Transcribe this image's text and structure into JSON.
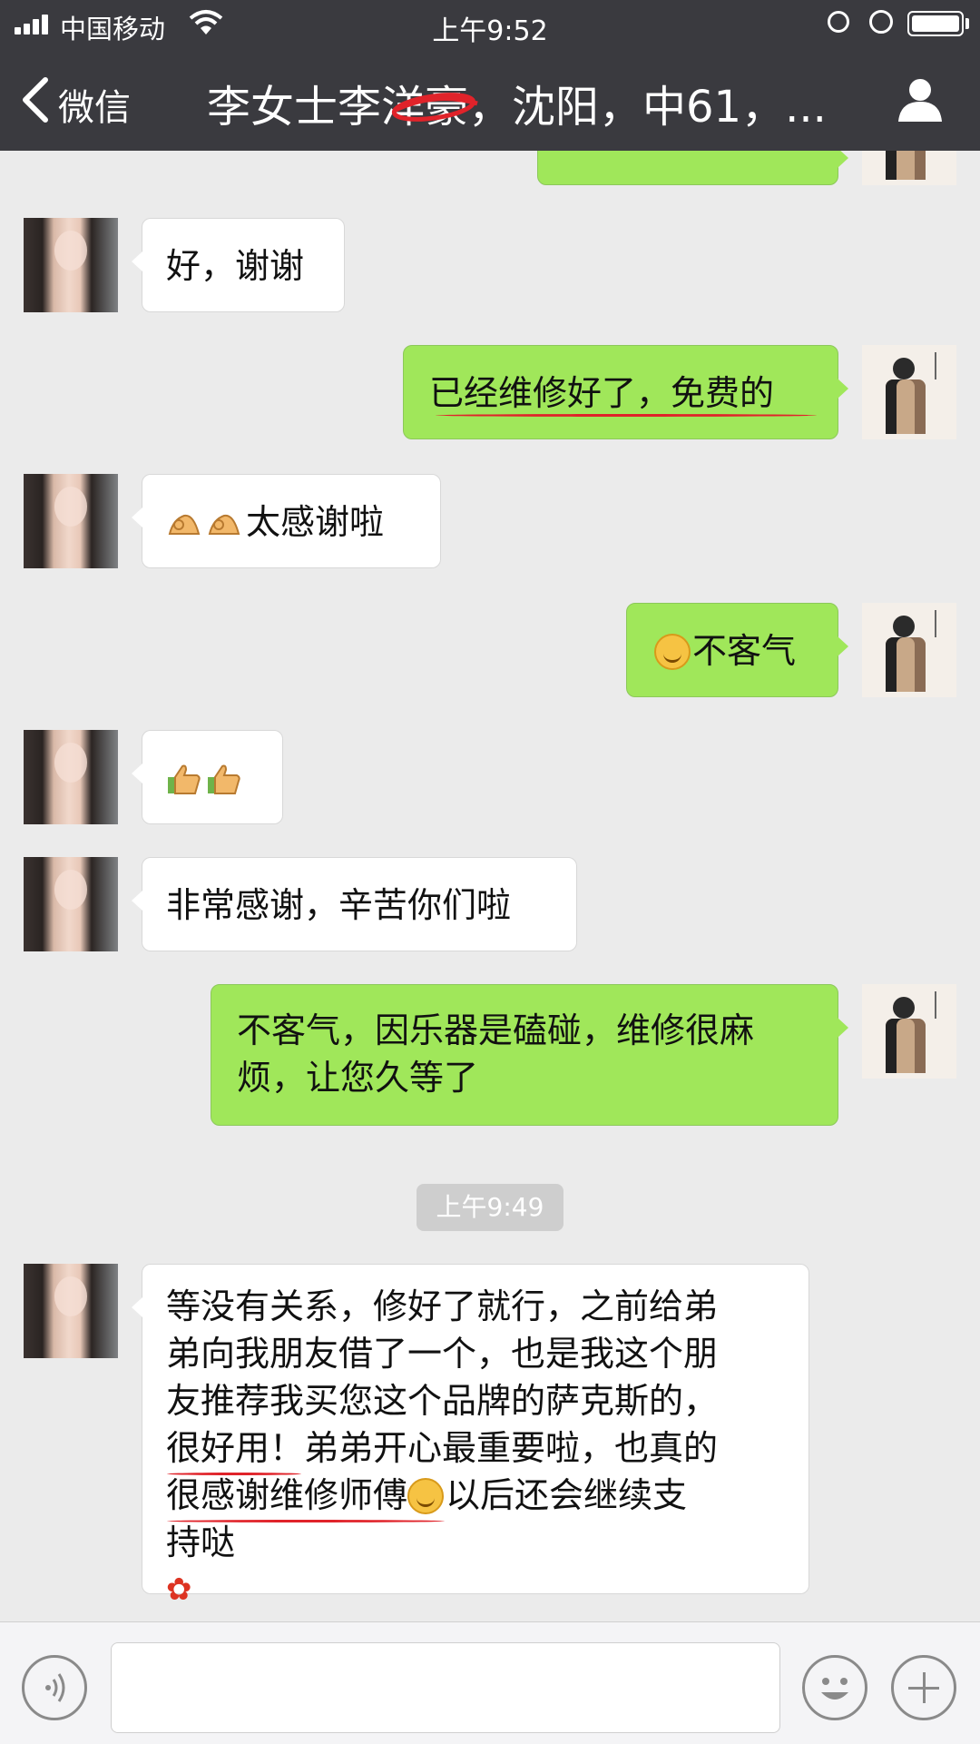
{
  "status_bar": {
    "carrier": "中国移动",
    "time": "上午9:52"
  },
  "nav": {
    "back_label": "微信",
    "title": "李女士李洋豪，沈阳，中61，..."
  },
  "messages": [
    {
      "side": "out",
      "text": "",
      "note": "partially hidden bubble"
    },
    {
      "side": "in",
      "text": "好，谢谢"
    },
    {
      "side": "out",
      "text": "已经维修好了，免费的"
    },
    {
      "side": "in",
      "text": "太感谢啦",
      "emoji": "ok-hand x2"
    },
    {
      "side": "out",
      "text": "不客气",
      "emoji": "smile"
    },
    {
      "side": "in",
      "text": "",
      "emoji": "thumbs-up x2"
    },
    {
      "side": "in",
      "text": "非常感谢，辛苦你们啦"
    },
    {
      "side": "out",
      "lines": [
        "不客气，因乐器是磕碰，维修很麻",
        "烦，让您久等了"
      ]
    },
    {
      "side": "in",
      "lines": [
        "等没有关系，修好了就行，之前给弟",
        "弟向我朋友借了一个，也是我这个朋",
        "友推荐我买您这个品牌的萨克斯的，",
        "很好用！弟弟开心最重要啦，也真的",
        "很感谢维修师傅",
        "以后还会继续支",
        "持哒"
      ]
    }
  ],
  "timestamp": "上午9:49",
  "icons": {
    "back": "chevron-left-icon",
    "profile": "person-icon",
    "voice": "voice-icon",
    "emoji": "smiley-icon",
    "plus": "plus-icon"
  },
  "colors": {
    "nav_bg": "#3a3a3f",
    "chat_bg": "#ebebeb",
    "out_bubble": "#a0e75a",
    "in_bubble": "#ffffff",
    "annotation_red": "#e0232a"
  }
}
